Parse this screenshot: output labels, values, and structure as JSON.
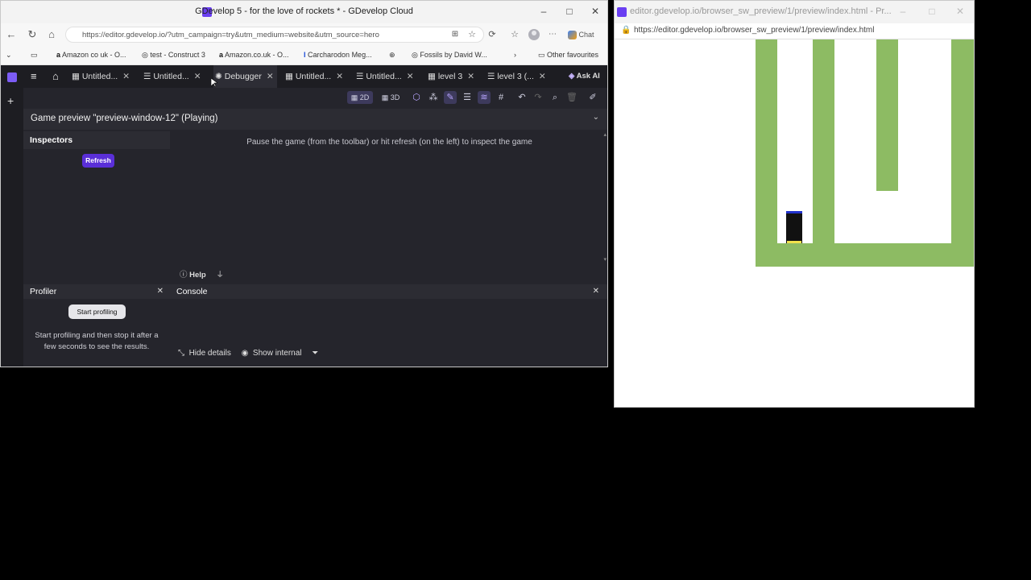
{
  "left_window": {
    "title": "GDevelop 5 - for the love of rockets * - GDevelop Cloud",
    "url": "https://editor.gdevelop.io/?utm_campaign=try&utm_medium=website&utm_source=hero",
    "chat_label": "Chat",
    "bookmarks": [
      "Amazon co uk - O...",
      "test - Construct 3",
      "Amazon.co.uk - O...",
      "Carcharodon Meg...",
      "Fossils by David W..."
    ],
    "other_favourites": "Other favourites"
  },
  "gdevelop": {
    "tabs": [
      {
        "label": "Untitled...",
        "icon": "scene-icon"
      },
      {
        "label": "Untitled...",
        "icon": "events-icon"
      },
      {
        "label": "Debugger",
        "icon": "debugger-icon"
      },
      {
        "label": "Untitled...",
        "icon": "scene-icon"
      },
      {
        "label": "Untitled...",
        "icon": "events-icon"
      },
      {
        "label": "level 3",
        "icon": "scene-icon"
      },
      {
        "label": "level 3 (...",
        "icon": "events-icon"
      }
    ],
    "ask_ai": "Ask AI",
    "toolbar": {
      "mode_2d": "2D",
      "mode_3d": "3D"
    },
    "preview_title": "Game preview \"preview-window-12\" (Playing)",
    "inspectors_label": "Inspectors",
    "refresh_label": "Refresh",
    "inspect_message": "Pause the game (from the toolbar) or hit refresh (on the left) to inspect the game",
    "help_label": "Help",
    "profiler": {
      "title": "Profiler",
      "start_button": "Start profiling",
      "hint": "Start profiling and then stop it after a few seconds to see the results."
    },
    "console": {
      "title": "Console",
      "hide_details": "Hide details",
      "show_internal": "Show internal"
    }
  },
  "right_window": {
    "title": "editor.gdevelop.io/browser_sw_preview/1/preview/index.html - Pr...",
    "url": "https://editor.gdevelop.io/browser_sw_preview/1/preview/index.html"
  },
  "colors": {
    "accent_purple": "#5a2fd8",
    "game_green": "#8dbb63",
    "editor_bg": "#25252c"
  }
}
